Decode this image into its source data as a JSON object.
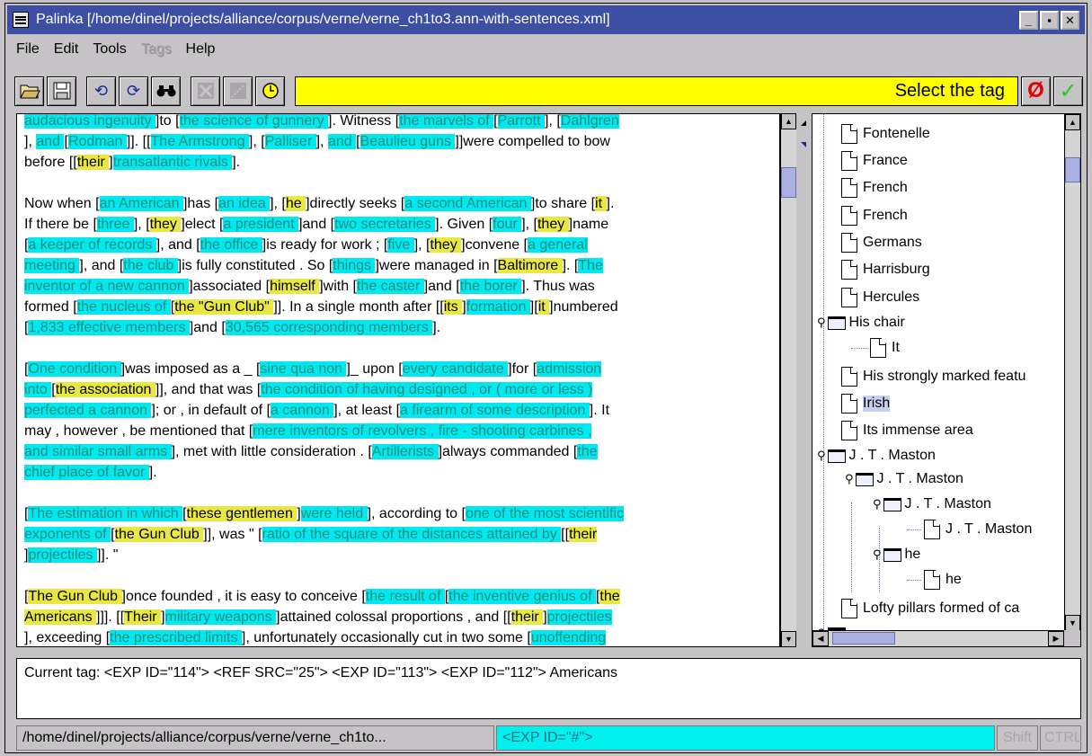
{
  "window": {
    "title": "Palinka [/home/dinel/projects/alliance/corpus/verne/verne_ch1to3.ann-with-sentences.xml]"
  },
  "menu": [
    {
      "label": "File",
      "enabled": true
    },
    {
      "label": "Edit",
      "enabled": true
    },
    {
      "label": "Tools",
      "enabled": true
    },
    {
      "label": "Tags",
      "enabled": false
    },
    {
      "label": "Help",
      "enabled": true
    }
  ],
  "toolbar": {
    "prompt": "Select the tag"
  },
  "colors": {
    "markable": "#00e8f0",
    "reference": "#e8e840",
    "prompt_bg": "#ffff00",
    "title_bg": "#3d4fa3"
  },
  "tree": {
    "nodes": [
      {
        "label": "Fontenelle",
        "type": "doc"
      },
      {
        "label": "France",
        "type": "doc"
      },
      {
        "label": "French",
        "type": "doc"
      },
      {
        "label": "French",
        "type": "doc"
      },
      {
        "label": "Germans",
        "type": "doc"
      },
      {
        "label": "Harrisburg",
        "type": "doc"
      },
      {
        "label": "Hercules",
        "type": "doc"
      },
      {
        "label": "His chair",
        "type": "folder"
      },
      {
        "label": "It",
        "type": "doc"
      },
      {
        "label": "His strongly marked featu",
        "type": "doc"
      },
      {
        "label": "Irish",
        "type": "doc",
        "selected": true
      },
      {
        "label": "Its immense area",
        "type": "doc"
      },
      {
        "label": "J . T . Maston",
        "type": "folder"
      },
      {
        "label": "J . T . Maston",
        "type": "folder"
      },
      {
        "label": "J . T . Maston",
        "type": "folder"
      },
      {
        "label": "J . T . Maston",
        "type": "doc"
      },
      {
        "label": "he",
        "type": "folder"
      },
      {
        "label": "he",
        "type": "doc"
      },
      {
        "label": "Lofty pillars formed of ca",
        "type": "doc"
      }
    ]
  },
  "current_tag": {
    "text": "Current tag: <EXP ID=\"114\"> <REF SRC=\"25\"> <EXP ID=\"113\"> <EXP ID=\"112\"> Americans"
  },
  "status": {
    "path": "/home/dinel/projects/alliance/corpus/verne/verne_ch1to...",
    "exp": "<EXP ID=\"#\">",
    "shift": "Shift",
    "ctrl": "CTRL"
  }
}
